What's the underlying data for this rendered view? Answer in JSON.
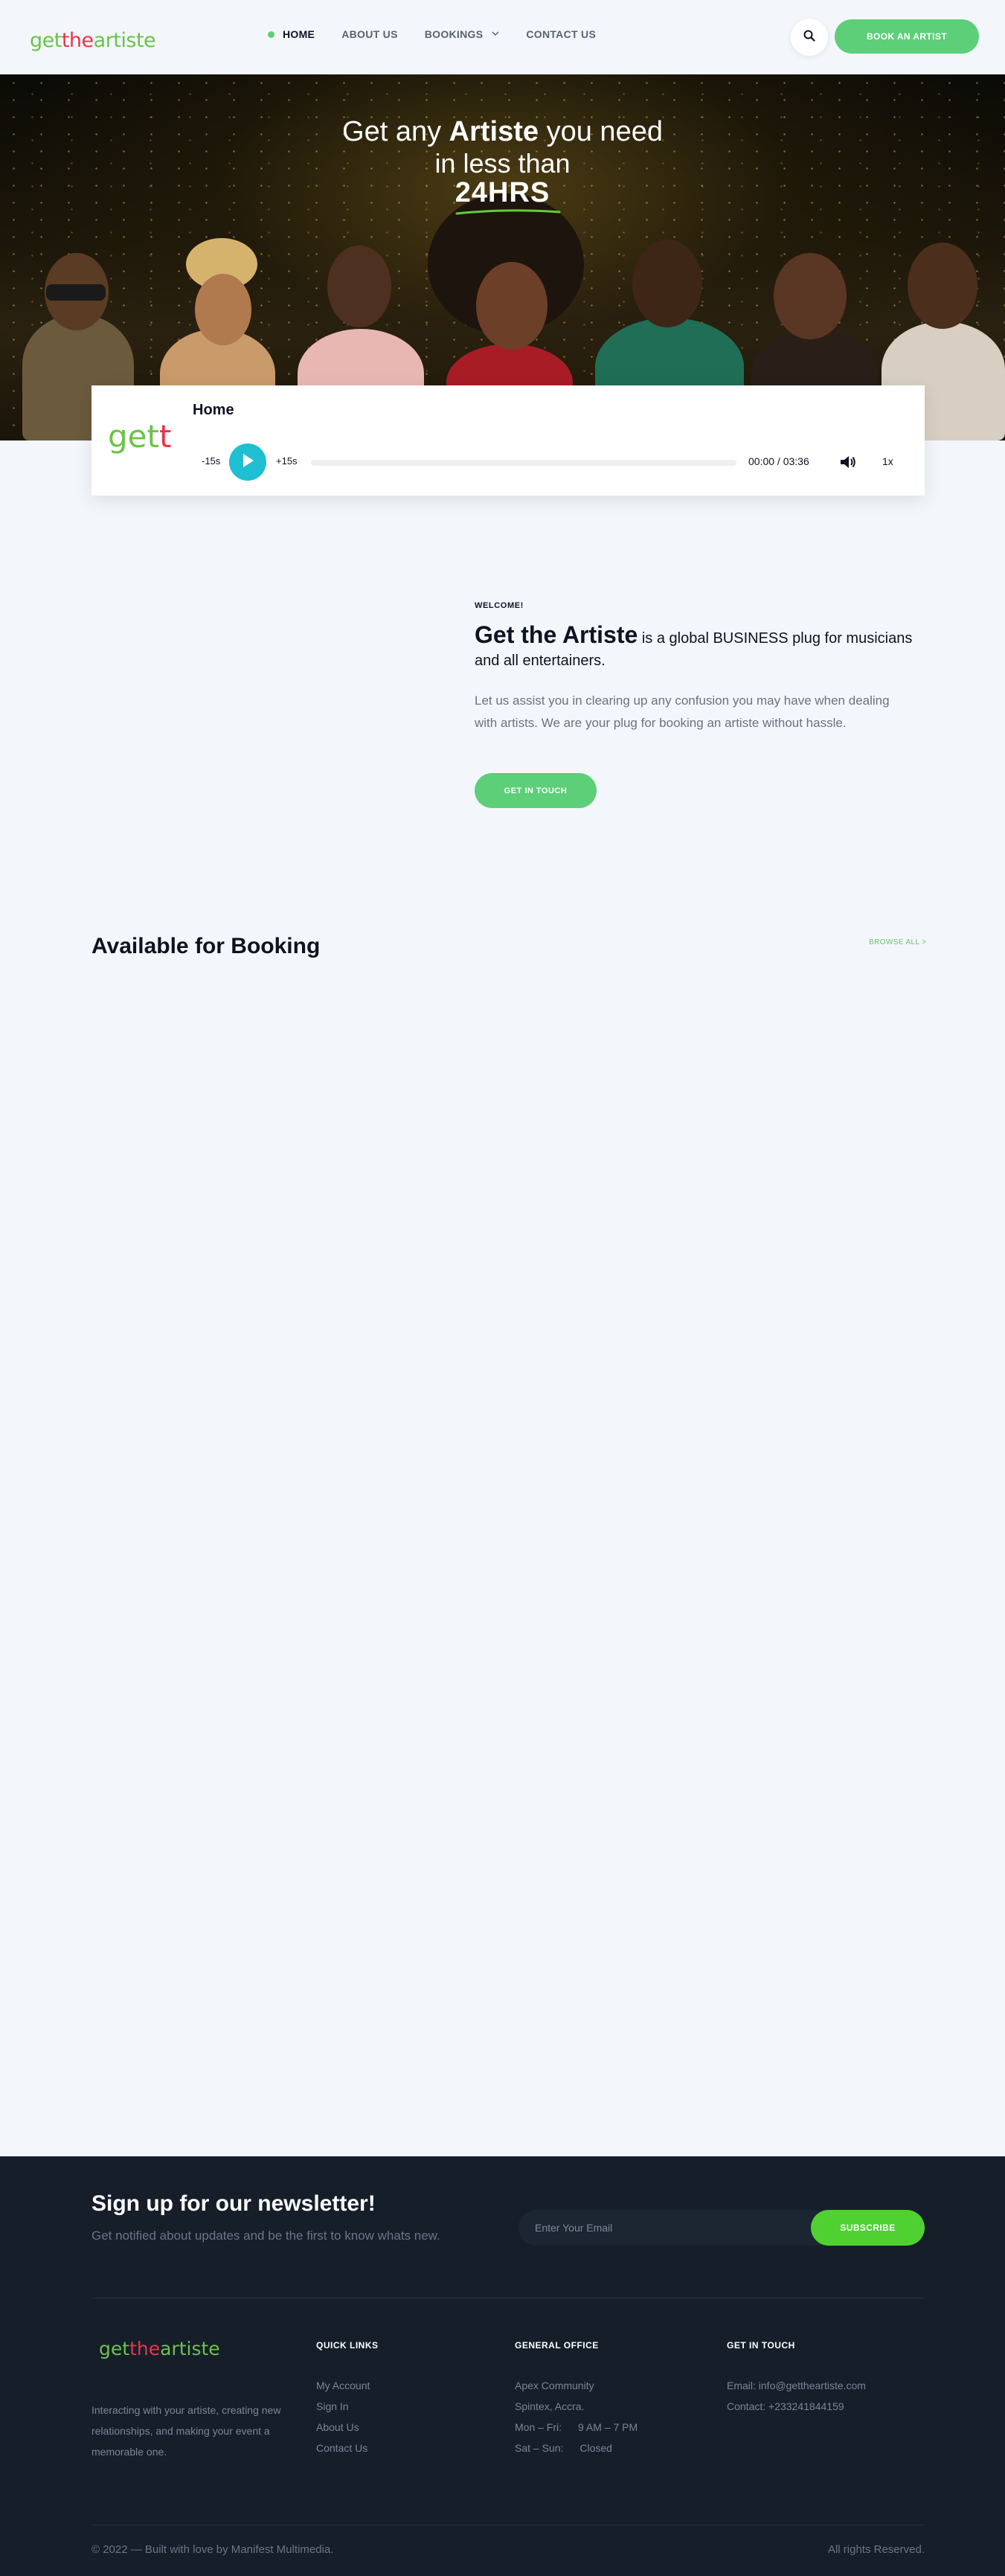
{
  "brand": {
    "logo_text": "gettheartiste"
  },
  "nav": {
    "items": [
      {
        "label": "HOME",
        "active": true
      },
      {
        "label": "ABOUT US",
        "active": false
      },
      {
        "label": "BOOKINGS",
        "active": false,
        "has_dropdown": true
      },
      {
        "label": "CONTACT US",
        "active": false
      }
    ],
    "search_icon": "search-icon",
    "cta_label": "BOOK AN ARTIST"
  },
  "hero": {
    "line1_pre": "Get any ",
    "line1_bold": "Artiste",
    "line1_post": " you need",
    "line2": "in less than",
    "line3": "24HRS"
  },
  "player": {
    "title": "Home",
    "rewind_label": "-15s",
    "forward_label": "+15s",
    "time_current": "00:00",
    "time_total": "03:36",
    "rate_label": "1x",
    "progress": 0,
    "icons": [
      "play-icon",
      "volume-icon"
    ]
  },
  "welcome": {
    "tag": "WELCOME!",
    "heading_bold": "Get the Artiste",
    "heading_rest": " is a global BUSINESS plug for musicians and all entertainers.",
    "body": "Let us assist you in clearing up any confusion you may have when dealing with artists. We are your plug for booking an artiste without hassle.",
    "cta_label": "GET IN TOUCH"
  },
  "booking": {
    "title": "Available for Booking",
    "browse_label": "BROWSE ALL >"
  },
  "newsletter": {
    "title": "Sign up for our newsletter!",
    "subtitle": "Get notified about updates and be the first to know whats new.",
    "input_placeholder": "Enter Your Email",
    "button_label": "SUBSCRIBE"
  },
  "footer": {
    "about": "Interacting with your artiste, creating new relationships, and making your event a memorable one.",
    "quick_links": {
      "title": "QUICK LINKS",
      "items": [
        "My Account",
        "Sign In",
        "About Us",
        "Contact Us"
      ]
    },
    "general_office": {
      "title": "GENERAL OFFICE",
      "lines": [
        "Apex Community",
        "Spintex, Accra."
      ],
      "hours": [
        {
          "day": "Mon – Fri:",
          "time": "9 AM – 7 PM"
        },
        {
          "day": "Sat – Sun:",
          "time": "Closed"
        }
      ]
    },
    "get_in_touch": {
      "title": "GET IN TOUCH",
      "email": "Email: info@gettheartiste.com",
      "contact": "Contact: +233241844159"
    },
    "copyright": "© 2022 — Built with love by Manifest Multimedia.",
    "rights": "All rights Reserved."
  },
  "colors": {
    "accent_green": "#5ccf78",
    "brand_red": "#e8344a",
    "play_teal": "#1fbfd1",
    "footer_bg": "#161e2a",
    "subscribe_green": "#4fd132"
  }
}
